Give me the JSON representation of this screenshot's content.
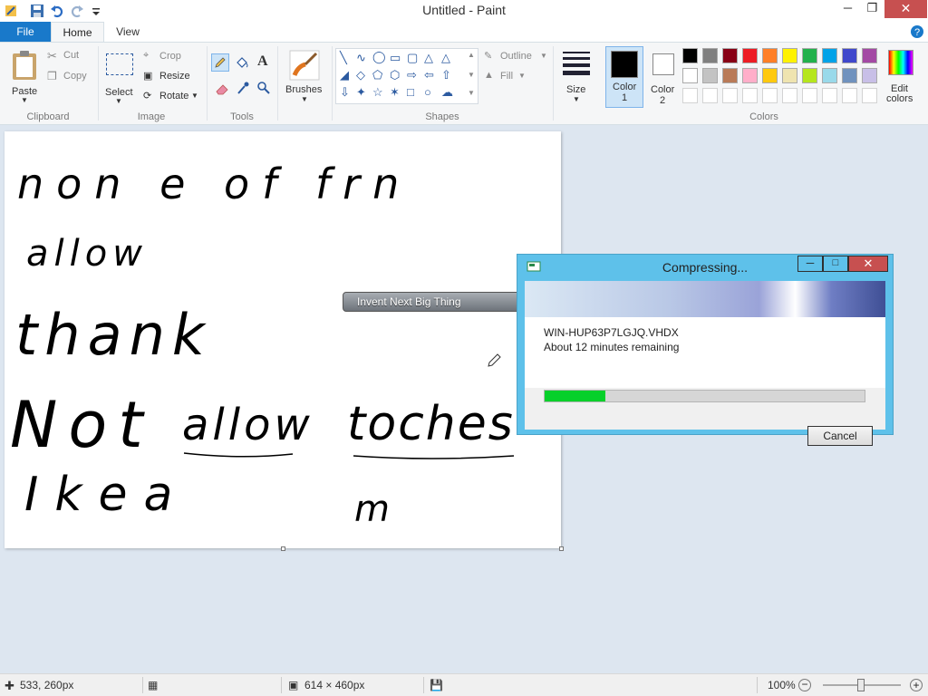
{
  "window": {
    "title": "Untitled - Paint"
  },
  "tabs": [
    {
      "label": "File"
    },
    {
      "label": "Home"
    },
    {
      "label": "View"
    }
  ],
  "ribbon": {
    "clipboard": {
      "group_label": "Clipboard",
      "paste": "Paste",
      "cut": "Cut",
      "copy": "Copy"
    },
    "image": {
      "group_label": "Image",
      "select": "Select",
      "crop": "Crop",
      "resize": "Resize",
      "rotate": "Rotate"
    },
    "tools": {
      "group_label": "Tools"
    },
    "brushes": {
      "label": "Brushes"
    },
    "shapes": {
      "group_label": "Shapes",
      "outline": "Outline",
      "fill": "Fill"
    },
    "size": {
      "label": "Size"
    },
    "color1": {
      "label": "Color",
      "num": "1",
      "value": "#000000"
    },
    "color2": {
      "label": "Color",
      "num": "2",
      "value": "#ffffff"
    },
    "colors": {
      "group_label": "Colors",
      "edit_label_1": "Edit",
      "edit_label_2": "colors",
      "palette_row1": [
        "#000000",
        "#7f7f7f",
        "#880015",
        "#ed1c24",
        "#ff7f27",
        "#fff200",
        "#22b14c",
        "#00a2e8",
        "#3f48cc",
        "#a349a4"
      ],
      "palette_row2": [
        "#ffffff",
        "#c3c3c3",
        "#b97a57",
        "#ffaec9",
        "#ffc90e",
        "#efe4b0",
        "#b5e61d",
        "#99d9ea",
        "#7092be",
        "#c8bfe7"
      ]
    }
  },
  "canvas_text": {
    "line1": "non e of frn",
    "line2": "allow",
    "line3": "thank",
    "line4a": "Not",
    "line4b": "allow",
    "line4c": "toches",
    "line5": "Ikea",
    "line5b": "m"
  },
  "floating_toolbar": {
    "label": "Invent Next Big Thing"
  },
  "dialog": {
    "title": "Compressing...",
    "filename": "WIN-HUP63P7LGJQ.VHDX",
    "time_remaining": "About 12 minutes remaining",
    "progress_fraction": 0.19,
    "cancel": "Cancel"
  },
  "statusbar": {
    "cursor_pos": "533, 260px",
    "canvas_size": "614 × 460px",
    "zoom": "100%"
  }
}
